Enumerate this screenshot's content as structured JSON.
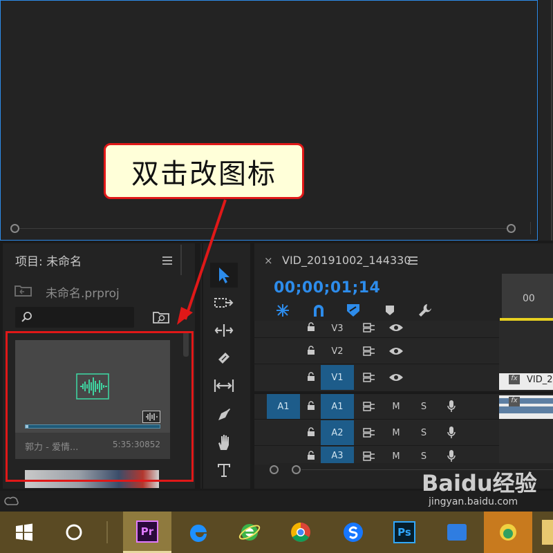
{
  "callout": {
    "text": "双击改图标"
  },
  "project": {
    "title": "项目: 未命名",
    "file_name": "未命名.prproj",
    "search": {
      "value": "",
      "placeholder": ""
    },
    "clip": {
      "name": "郭力 - 爱情...",
      "duration": "5:35:30852",
      "progress": 0.02
    }
  },
  "timeline": {
    "tab_label": "VID_20191002_144330",
    "timecode": "00;00;01;14",
    "ruler_label": "00",
    "video_tracks": [
      {
        "name": "V3",
        "target": ""
      },
      {
        "name": "V2",
        "target": ""
      },
      {
        "name": "V1",
        "target": "V1"
      }
    ],
    "audio_tracks": [
      {
        "name": "A1",
        "source": "A1",
        "m": "M",
        "s": "S"
      },
      {
        "name": "A2",
        "source": "",
        "m": "M",
        "s": "S"
      },
      {
        "name": "A3",
        "source": "",
        "m": "M",
        "s": "S"
      }
    ],
    "clip_v1": {
      "fx": "fx",
      "label": "VID_2"
    },
    "clip_a1": {
      "fx": "fx"
    }
  },
  "taskbar": {
    "premiere_label": "Pr",
    "photoshop_label": "Ps",
    "watermark_brand": "Baidu经验",
    "watermark_url": "jingyan.baidu.com"
  },
  "colors": {
    "accent": "#2d8ceb",
    "annotation_red": "#e01818",
    "callout_bg": "#ffffd9",
    "track_blue": "#1d5c8a",
    "taskbar": "#5a4a23",
    "audio_waveform": "#3fd3a0"
  },
  "icons": [
    "windows-start-icon",
    "cortana-icon",
    "premiere-icon",
    "edge-icon",
    "ie-icon",
    "chrome-icon",
    "sogou-icon",
    "photoshop-icon",
    "creative-cloud-icon",
    "hamburger-icon",
    "search-icon",
    "folder-icon",
    "selection-tool-icon",
    "track-select-icon",
    "ripple-edit-icon",
    "razor-icon",
    "slip-icon",
    "pen-icon",
    "hand-icon",
    "type-icon",
    "snap-icon",
    "linked-selection-icon",
    "marker-icon",
    "wrench-icon",
    "lock-icon",
    "eye-icon",
    "mic-icon"
  ]
}
